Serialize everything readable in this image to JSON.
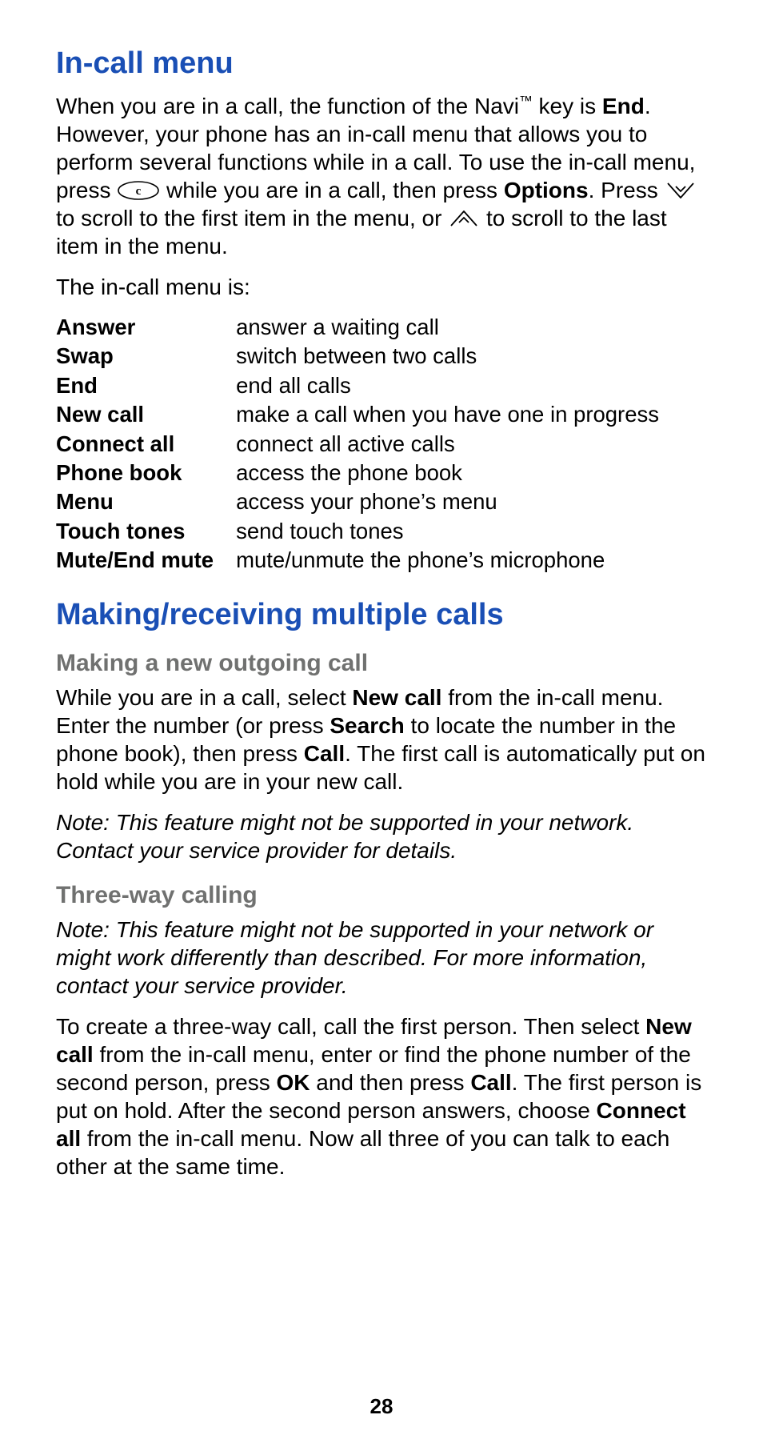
{
  "heading1": "In-call menu",
  "intro": {
    "p1a": "When you are in a call, the  function of the Navi",
    "tm": "™",
    "p1b": " key  is ",
    "end": "End",
    "p1c": ". However, your phone has an in-call menu that allows you to perform several functions while in a call. To use the in-call menu, press  ",
    "p1d": "  while you are in a call, then press ",
    "options": "Options",
    "p1e": ". Press ",
    "p1f": " to scroll to the first item in the menu, or ",
    "p1g": " to scroll to the last item in the menu."
  },
  "intro2": "The in-call menu is:",
  "menu": [
    {
      "term": "Answer",
      "desc": "answer a waiting call"
    },
    {
      "term": "Swap",
      "desc": "switch between two calls"
    },
    {
      "term": "End",
      "desc": "end all calls"
    },
    {
      "term": "New call",
      "desc": "make a call when you have one in progress"
    },
    {
      "term": "Connect all",
      "desc": "connect all active calls"
    },
    {
      "term": "Phone book",
      "desc": "access the phone book"
    },
    {
      "term": "Menu",
      "desc": "access your phone’s menu"
    },
    {
      "term": "Touch tones",
      "desc": "send touch tones"
    },
    {
      "term": "Mute/End mute",
      "desc": "mute/unmute the phone’s microphone"
    }
  ],
  "heading2": "Making/receiving multiple calls",
  "sub1": "Making a new outgoing call",
  "outgoing": {
    "a": "While you are in a call, select ",
    "newcall": "New call",
    "b": " from the in-call menu. Enter the number (or press ",
    "search": "Search",
    "c": " to locate the number in the phone book), then press ",
    "call": "Call",
    "d": ". The first call is automatically put on hold while you are in your new call."
  },
  "note1": "Note:  This feature might not be supported in your network. Contact your service provider for details.",
  "sub2": "Three-way calling",
  "note2": "Note:  This feature might not be supported in your network or might work differently than described. For more information, contact your service provider.",
  "threeway": {
    "a": "To create a three-way call, call the first person. Then select ",
    "newcall": "New call",
    "b": " from the in-call menu, enter or find the phone number of the second person, press ",
    "ok": "OK",
    "c": " and then press ",
    "call": "Call",
    "d": ". The first person is put on hold. After the second person answers, choose ",
    "connectall": "Connect all",
    "e": " from the in-call menu. Now all three of you can talk to each other at the same time."
  },
  "page": "28"
}
